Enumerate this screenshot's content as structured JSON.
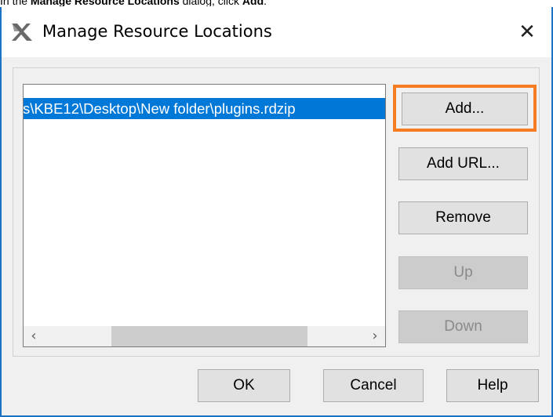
{
  "caption": {
    "prefix": "In the ",
    "dialog_name": "Manage Resource Locations",
    "middle": " dialog, click ",
    "action": "Add",
    "suffix": "."
  },
  "dialog": {
    "title": "Manage Resource Locations",
    "close_glyph": "✕",
    "list": {
      "items": [
        "s\\KBE12\\Desktop\\New folder\\plugins.rdzip"
      ],
      "scroll_left_glyph": "‹",
      "scroll_right_glyph": "›"
    },
    "side_buttons": {
      "add": "Add...",
      "add_url": "Add URL...",
      "remove": "Remove",
      "up": "Up",
      "down": "Down"
    },
    "footer_buttons": {
      "ok": "OK",
      "cancel": "Cancel",
      "help": "Help"
    }
  },
  "colors": {
    "selection": "#0078d7",
    "highlight": "#f57c20",
    "window_border": "#1c73c4"
  },
  "icons": {
    "app": "magicdraw-app-icon",
    "close": "close-icon"
  }
}
